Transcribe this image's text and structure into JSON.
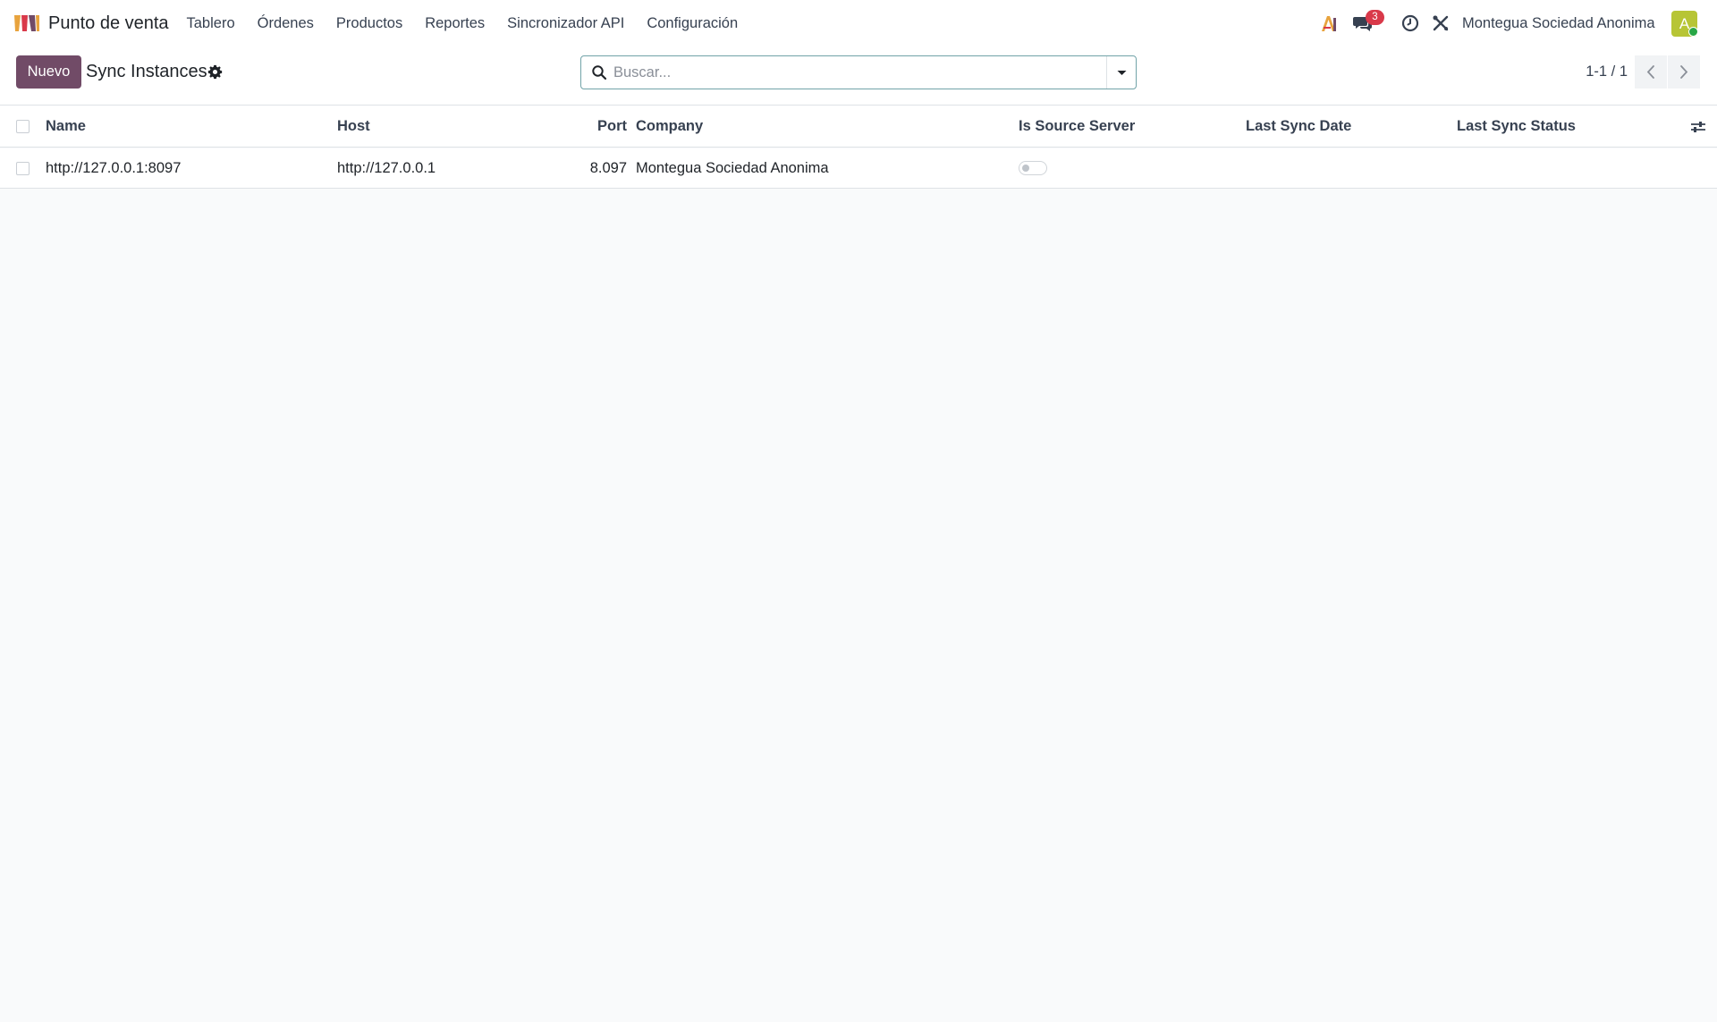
{
  "navbar": {
    "app_name": "Punto de venta",
    "menu": [
      {
        "label": "Tablero"
      },
      {
        "label": "Órdenes"
      },
      {
        "label": "Productos"
      },
      {
        "label": "Reportes"
      },
      {
        "label": "Sincronizador API"
      },
      {
        "label": "Configuración"
      }
    ],
    "messages_badge": "3",
    "company": "Montegua Sociedad Anonima",
    "avatar_letter": "A",
    "icons": [
      "app-logo-icon",
      "ai-icon",
      "messages-icon",
      "activity-clock-icon",
      "debug-tools-icon"
    ]
  },
  "control_panel": {
    "new_button": "Nuevo",
    "title": "Sync Instances",
    "search_placeholder": "Buscar...",
    "pager": "1-1 / 1"
  },
  "table": {
    "columns": {
      "name": "Name",
      "host": "Host",
      "port": "Port",
      "company": "Company",
      "is_source": "Is Source Server",
      "last_sync_date": "Last Sync Date",
      "last_sync_status": "Last Sync Status"
    },
    "rows": [
      {
        "name": "http://127.0.0.1:8097",
        "host": "http://127.0.0.1",
        "port": "8.097",
        "company": "Montegua Sociedad Anonima",
        "is_source_server": false,
        "last_sync_date": "",
        "last_sync_status": ""
      }
    ]
  },
  "colors": {
    "primary": "#714b67",
    "badge": "#d9394a",
    "avatar": "#b7c535",
    "online": "#28a745"
  }
}
